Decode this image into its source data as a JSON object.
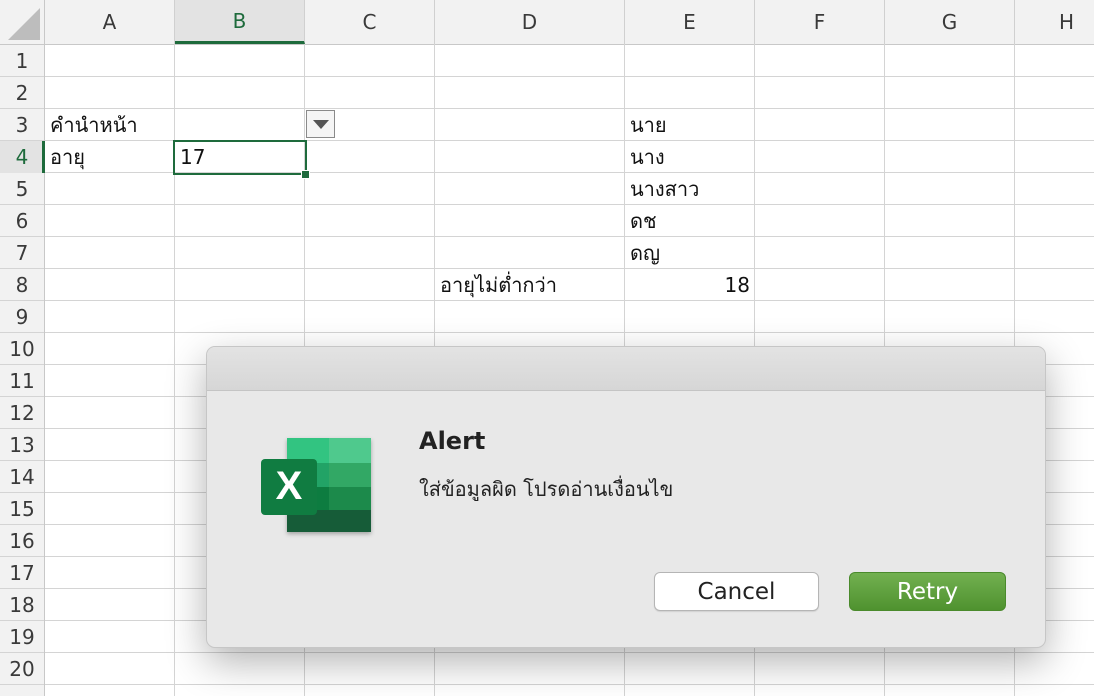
{
  "spreadsheet": {
    "columns": [
      "A",
      "B",
      "C",
      "D",
      "E",
      "F",
      "G",
      "H"
    ],
    "rows": [
      "1",
      "2",
      "3",
      "4",
      "5",
      "6",
      "7",
      "8",
      "9",
      "10",
      "11",
      "12",
      "13",
      "14",
      "15",
      "16",
      "17",
      "18",
      "19",
      "20"
    ],
    "selected_column": "B",
    "selected_row": "4",
    "cells": {
      "A3": "คำนำหน้า",
      "A4": "อายุ",
      "B4": "17",
      "D8": "อายุไม่ต่ำกว่า",
      "E3": "นาย",
      "E4": "นาง",
      "E5": "นางสาว",
      "E6": "ดช",
      "E7": "ดญ",
      "E8": "18"
    }
  },
  "dialog": {
    "title": "Alert",
    "message": "ใส่ข้อมูลผิด โปรดอ่านเงื่อนไข",
    "cancel_label": "Cancel",
    "retry_label": "Retry",
    "app_icon": "excel-icon",
    "app_icon_letter": "X"
  },
  "colors": {
    "excel_green": "#1e6b3c",
    "retry_button": "#5a9c38"
  }
}
